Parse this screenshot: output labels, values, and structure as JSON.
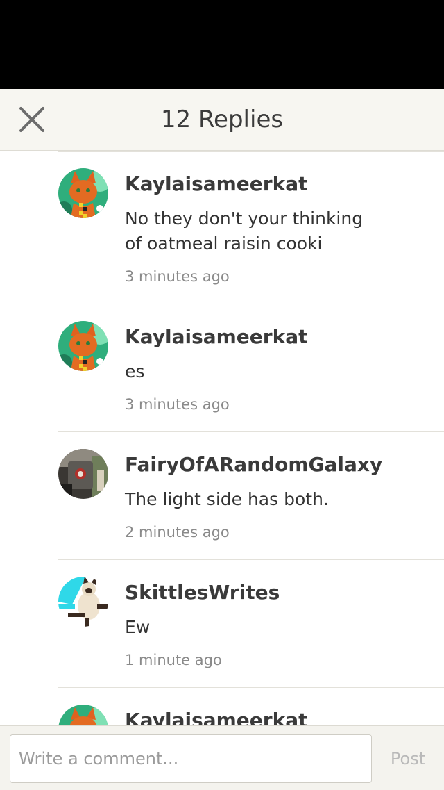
{
  "header": {
    "close_icon": "close-icon",
    "title": "12 Replies"
  },
  "replies": [
    {
      "avatar": "orange-cat-avatar",
      "username": "Kaylaisameerkat",
      "body": "No they don't your thinking of oatmeal raisin cooki",
      "time": "3 minutes ago"
    },
    {
      "avatar": "orange-cat-avatar",
      "username": "Kaylaisameerkat",
      "body": "es",
      "time": "3 minutes ago"
    },
    {
      "avatar": "galaxy-avatar",
      "username": "FairyOfARandomGalaxy",
      "body": "The light side has both.",
      "time": "2 minutes ago"
    },
    {
      "avatar": "siamese-cat-avatar",
      "username": "SkittlesWrites",
      "body": "Ew",
      "time": "1 minute ago"
    },
    {
      "avatar": "orange-cat-avatar",
      "username": "Kaylaisameerkat"
    }
  ],
  "composer": {
    "placeholder": "Write a comment...",
    "post_label": "Post"
  },
  "colors": {
    "header_bg": "#f7f6f1",
    "status_bar": "#000000",
    "divider": "#e3e1da",
    "post_disabled": "#b9b9b9"
  }
}
